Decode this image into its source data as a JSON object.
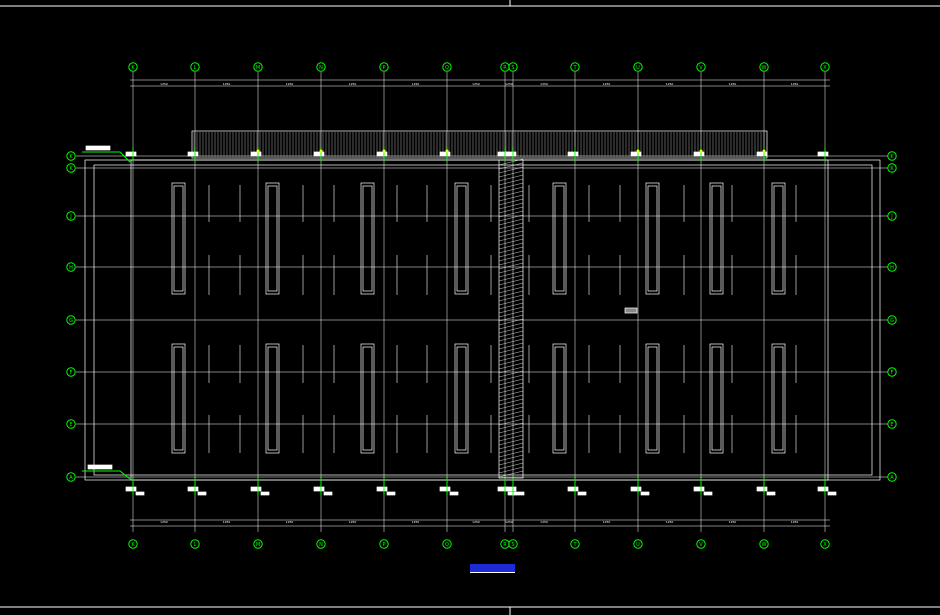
{
  "drawing": {
    "background": "#000000",
    "line_color": "#ffffff",
    "grid_bubble_color": "#00ff00",
    "accent_colors": [
      "#ffff00",
      "#ff00ff",
      "#1c2bd6"
    ],
    "title_label": "",
    "note_label": "",
    "top_axis_labels": [
      "K",
      "L",
      "M",
      "N",
      "P",
      "Q",
      "R",
      "S",
      "T",
      "U",
      "V",
      "W",
      "X"
    ],
    "bottom_axis_labels": [
      "K",
      "L",
      "M",
      "N",
      "P",
      "Q",
      "R",
      "S",
      "T",
      "U",
      "V",
      "W",
      "X"
    ],
    "left_axis_labels": [
      "K",
      "K",
      "J",
      "H",
      "G",
      "F",
      "E",
      "A"
    ],
    "right_axis_labels": [
      "K",
      "K",
      "J",
      "H",
      "G",
      "F",
      "E",
      "A"
    ],
    "dimension_text": "1250"
  }
}
